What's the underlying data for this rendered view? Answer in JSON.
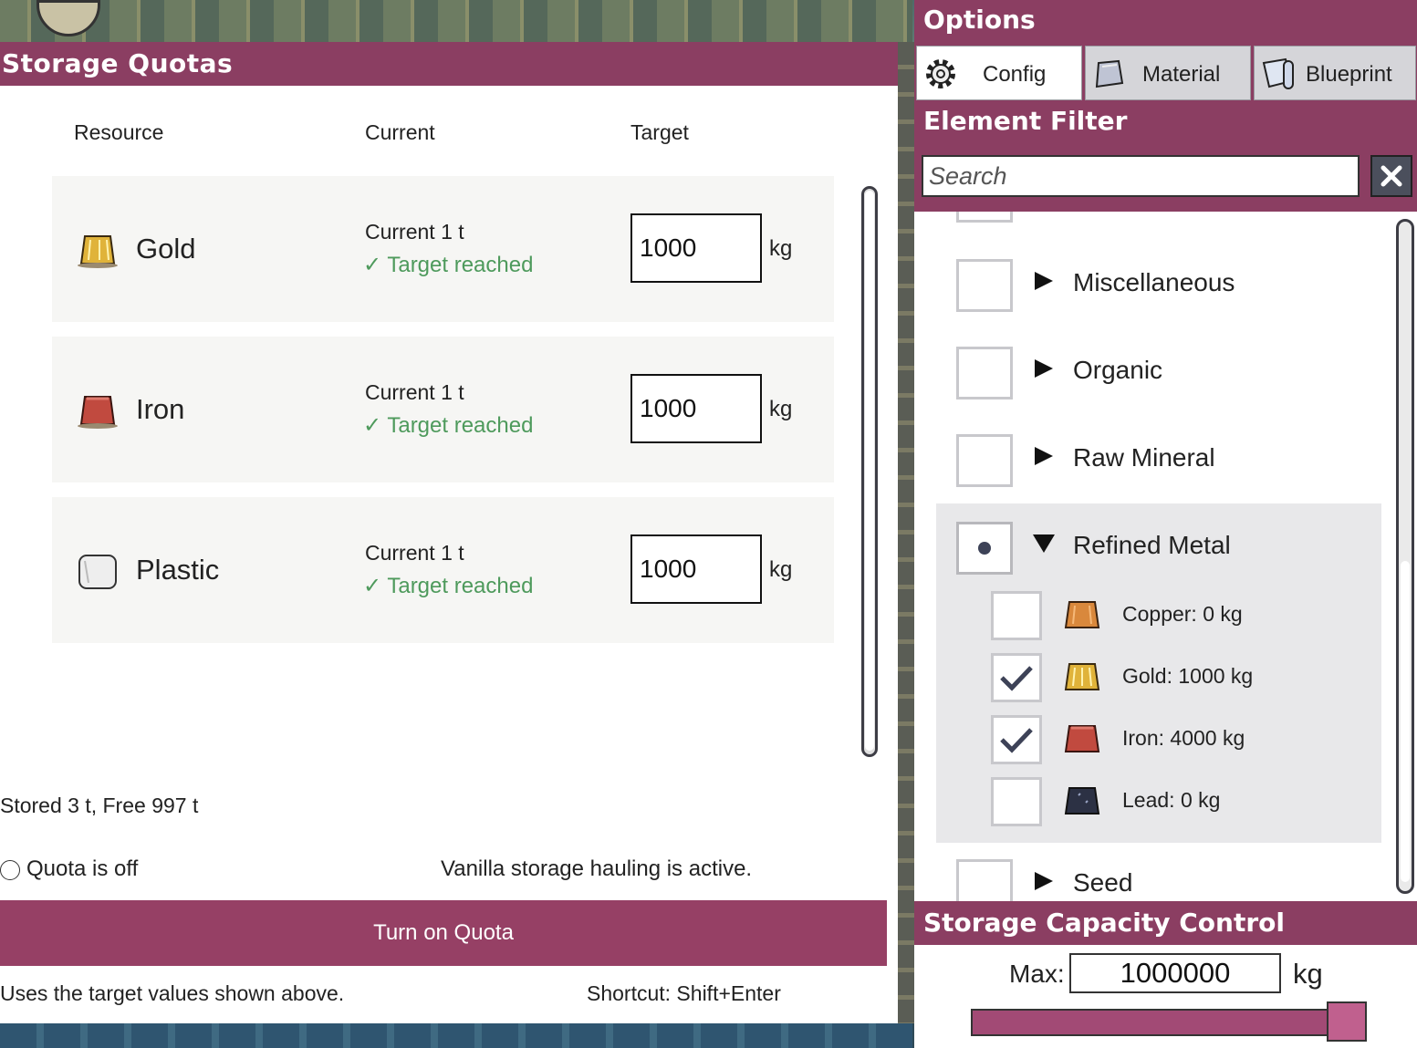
{
  "quotas": {
    "title": "Storage Quotas",
    "columns": {
      "resource": "Resource",
      "current": "Current",
      "target": "Target"
    },
    "rows": [
      {
        "name": "Gold",
        "current": "Current 1 t",
        "status": "✓ Target reached",
        "target": "1000",
        "unit": "kg",
        "icon": "gold-icon",
        "color": "#e0b33a"
      },
      {
        "name": "Iron",
        "current": "Current 1 t",
        "status": "✓ Target reached",
        "target": "1000",
        "unit": "kg",
        "icon": "iron-icon",
        "color": "#c14a3f"
      },
      {
        "name": "Plastic",
        "current": "Current 1 t",
        "status": "✓ Target reached",
        "target": "1000",
        "unit": "kg",
        "icon": "plastic-icon",
        "color": "#eeeeee"
      }
    ],
    "stored": "Stored 3 t, Free 997 t",
    "quota_state": "Quota is off",
    "vanilla_note": "Vanilla storage hauling is active.",
    "turn_on_label": "Turn on Quota",
    "uses_note": "Uses the target values shown above.",
    "shortcut": "Shortcut: Shift+Enter"
  },
  "options": {
    "title": "Options",
    "tabs": [
      {
        "label": "Config",
        "icon": "gear-icon",
        "active": true
      },
      {
        "label": "Material",
        "icon": "material-icon",
        "active": false
      },
      {
        "label": "Blueprint",
        "icon": "blueprint-icon",
        "active": false
      }
    ],
    "filter_title": "Element Filter",
    "search_placeholder": "Search",
    "categories": [
      {
        "label": "Miscellaneous",
        "expanded": false,
        "state": "unchecked"
      },
      {
        "label": "Organic",
        "expanded": false,
        "state": "unchecked"
      },
      {
        "label": "Raw Mineral",
        "expanded": false,
        "state": "unchecked"
      },
      {
        "label": "Refined Metal",
        "expanded": true,
        "state": "partial"
      },
      {
        "label": "Seed",
        "expanded": false,
        "state": "unchecked"
      }
    ],
    "refined_metals": [
      {
        "label": "Copper: 0 kg",
        "checked": false,
        "icon": "copper-icon",
        "color": "#d9883c"
      },
      {
        "label": "Gold: 1000 kg",
        "checked": true,
        "icon": "gold-icon",
        "color": "#e0b33a"
      },
      {
        "label": "Iron: 4000 kg",
        "checked": true,
        "icon": "iron-icon",
        "color": "#c14a3f"
      },
      {
        "label": "Lead: 0 kg",
        "checked": false,
        "icon": "lead-icon",
        "color": "#2c3144"
      }
    ],
    "capacity_title": "Storage Capacity Control",
    "max_label": "Max:",
    "max_value": "1000000",
    "max_unit": "kg",
    "capacity_fraction": 1.0
  },
  "colors": {
    "accent": "#8b3e62",
    "button": "#964065",
    "reached": "#4e9a5c"
  }
}
